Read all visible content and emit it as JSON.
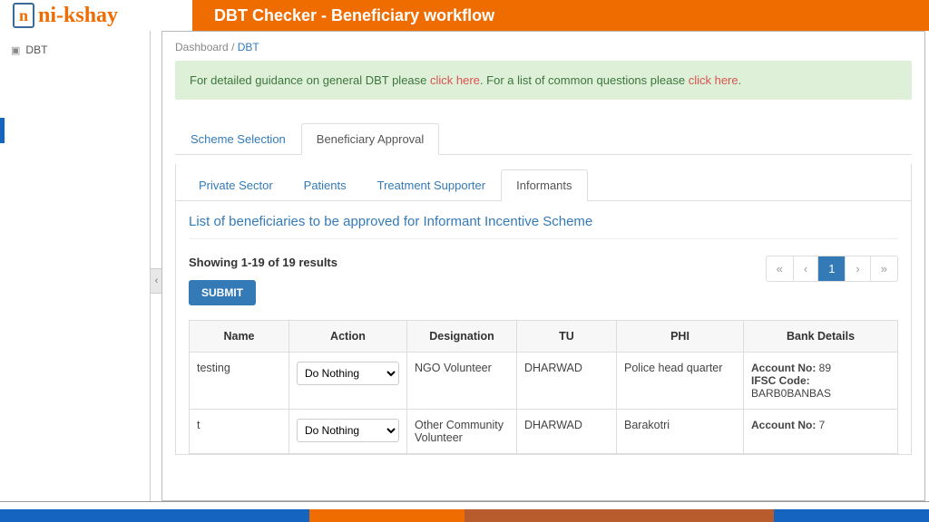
{
  "header": {
    "logo_text": "ni-kshay",
    "title": "DBT Checker - Beneficiary workflow"
  },
  "sidebar": {
    "items": [
      {
        "icon": "⦿",
        "label": "DBT"
      }
    ]
  },
  "breadcrumb": {
    "root": "Dashboard",
    "current": "DBT"
  },
  "notice": {
    "prefix": "For detailed guidance on general DBT please ",
    "link1": "click here",
    "mid": ". For a list of common questions please ",
    "link2": "click here",
    "suffix": "."
  },
  "tabs": {
    "items": [
      "Scheme Selection",
      "Beneficiary Approval"
    ],
    "active_index": 1
  },
  "subtabs": {
    "items": [
      "Private Sector",
      "Patients",
      "Treatment Supporter",
      "Informants"
    ],
    "active_index": 3
  },
  "list": {
    "title": "List of beneficiaries to be approved for Informant Incentive Scheme",
    "showing": "Showing 1-19 of 19 results",
    "submit_label": "SUBMIT"
  },
  "pager": {
    "first": "«",
    "prev": "‹",
    "current": "1",
    "next": "›",
    "last": "»"
  },
  "table": {
    "headers": [
      "Name",
      "Action",
      "Designation",
      "TU",
      "PHI",
      "Bank Details"
    ],
    "action_options": [
      "Do Nothing"
    ],
    "rows": [
      {
        "name": "testing",
        "action": "Do Nothing",
        "designation": "NGO Volunteer",
        "tu": "DHARWAD",
        "phi": "Police head quarter",
        "bank": {
          "acct_label": "Account No:",
          "acct": "89",
          "ifsc_label": "IFSC Code:",
          "ifsc": "BARB0BANBAS"
        }
      },
      {
        "name": "t",
        "action": "Do Nothing",
        "designation": "Other Community Volunteer",
        "tu": "DHARWAD",
        "phi": "Barakotri",
        "bank": {
          "acct_label": "Account No:",
          "acct": "7",
          "ifsc_label": "",
          "ifsc": ""
        }
      }
    ]
  },
  "footer_colors": [
    "#1565c0",
    "#1565c0",
    "#ef6c00",
    "#b85c2e",
    "#b85c2e",
    "#1565c0"
  ]
}
